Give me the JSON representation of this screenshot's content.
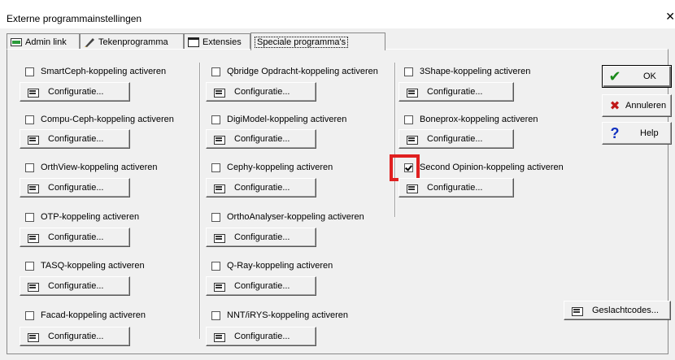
{
  "window": {
    "title": "Externe programmainstellingen",
    "close_glyph": "✕"
  },
  "tabs": [
    {
      "label": "Admin link",
      "icon": "admin-link-icon"
    },
    {
      "label": "Tekenprogramma",
      "icon": "pen-icon"
    },
    {
      "label": "Extensies",
      "icon": "window-icon"
    },
    {
      "label": "Speciale programma's",
      "icon": ""
    }
  ],
  "config_label": "Configuratie...",
  "columns": [
    {
      "items": [
        {
          "label": "SmartCeph-koppeling activeren",
          "checked": false
        },
        {
          "label": "Compu-Ceph-koppeling activeren",
          "checked": false
        },
        {
          "label": "OrthView-koppeling activeren",
          "checked": false
        },
        {
          "label": "OTP-koppeling activeren",
          "checked": false
        },
        {
          "label": "TASQ-koppeling activeren",
          "checked": false
        },
        {
          "label": "Facad-koppeling activeren",
          "checked": false
        }
      ]
    },
    {
      "items": [
        {
          "label": "Qbridge Opdracht-koppeling activeren",
          "checked": false
        },
        {
          "label": "DigiModel-koppeling activeren",
          "checked": false
        },
        {
          "label": "Cephy-koppeling activeren",
          "checked": false
        },
        {
          "label": "OrthoAnalyser-koppeling activeren",
          "checked": false
        },
        {
          "label": "Q-Ray-koppeling activeren",
          "checked": false
        },
        {
          "label": "NNT/iRYS-koppeling activeren",
          "checked": false
        }
      ]
    },
    {
      "items": [
        {
          "label": "3Shape-koppeling activeren",
          "checked": false
        },
        {
          "label": "Boneprox-koppeling activeren",
          "checked": false
        },
        {
          "label": "Second Opinion-koppeling activeren",
          "checked": true
        }
      ]
    }
  ],
  "geslachtcodes_label": "Geslachtcodes...",
  "side_buttons": [
    {
      "label": "OK",
      "glyph": "✔",
      "color": "#1a8a1a"
    },
    {
      "label": "Annuleren",
      "glyph": "✖",
      "color": "#c01818"
    },
    {
      "label": "Help",
      "glyph": "?",
      "color": "#1030c0"
    }
  ],
  "colors": {
    "highlight": "#e02020"
  }
}
